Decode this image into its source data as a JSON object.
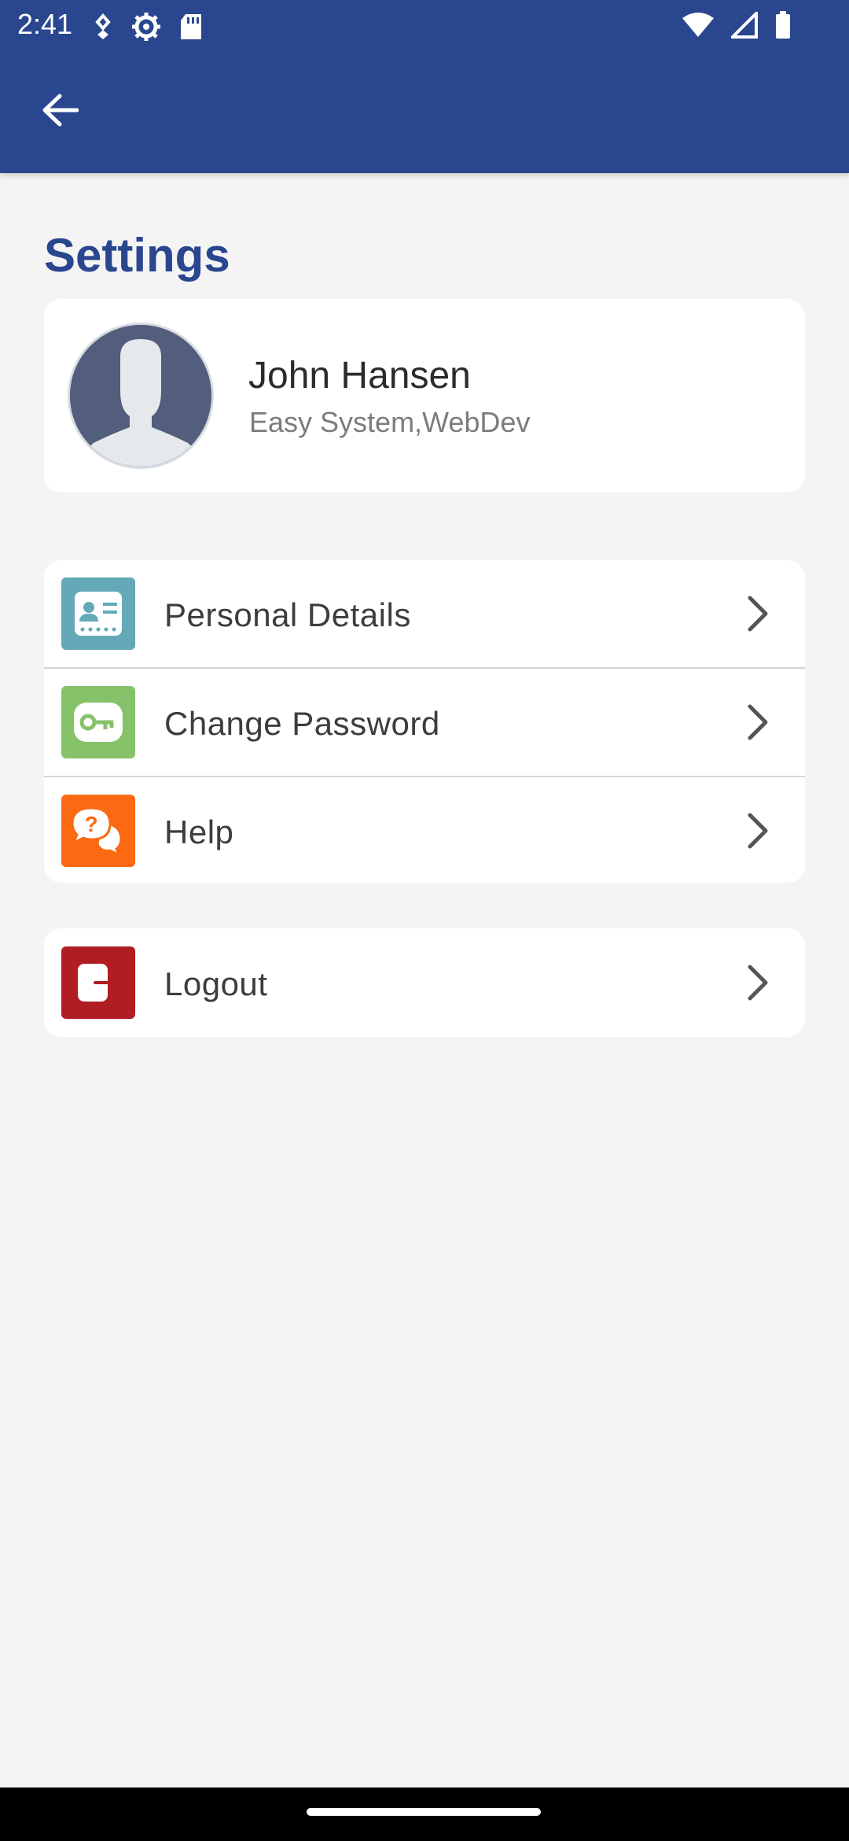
{
  "statusbar": {
    "time": "2:41"
  },
  "header": {
    "back_icon": "arrow-left-icon",
    "title": "Settings"
  },
  "profile": {
    "name": "John Hansen",
    "subtitle": "Easy System,WebDev",
    "avatar_icon": "user-silhouette-icon"
  },
  "menu": {
    "items": [
      {
        "label": "Personal Details",
        "icon": "id-card-icon",
        "color": "#63a9b8"
      },
      {
        "label": "Change Password",
        "icon": "key-icon",
        "color": "#85c26a"
      },
      {
        "label": "Help",
        "icon": "help-chat-icon",
        "color": "#fb6a12"
      }
    ]
  },
  "logout": {
    "label": "Logout",
    "icon": "logout-icon",
    "color": "#b01d22"
  },
  "colors": {
    "primary": "#29468f",
    "background": "#f4f4f4",
    "card": "#ffffff"
  }
}
